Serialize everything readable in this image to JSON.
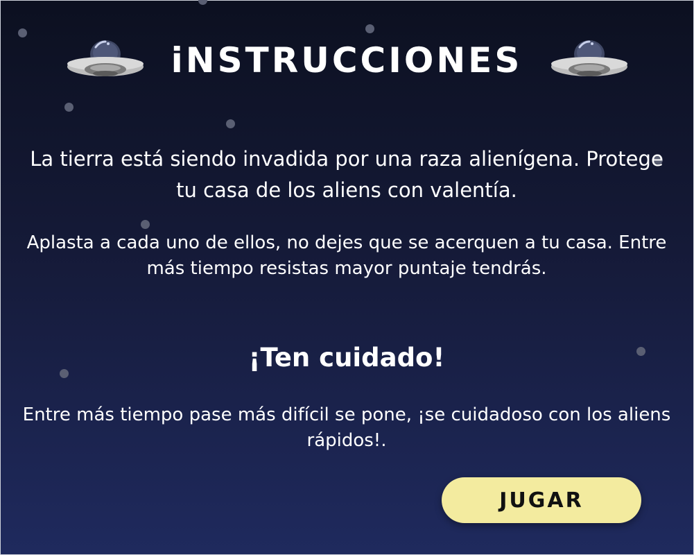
{
  "screen": {
    "title": "iNSTRUCCIONES",
    "paragraph_intro": "La tierra está siendo invadida por una raza alienígena. Protege tu casa de los aliens con valentía.",
    "paragraph_goal": "Aplasta a cada uno de ellos, no dejes que se acerquen a tu casa. Entre más tiempo resistas mayor puntaje tendrás.",
    "warning_heading": "¡Ten cuidado!",
    "paragraph_warning": "Entre más tiempo pase más difícil se pone, ¡se cuidadoso con los aliens rápidos!.",
    "play_button_label": "JUGAR"
  },
  "icons": {
    "left_decoration": "ufo-icon",
    "right_decoration": "ufo-icon"
  },
  "colors": {
    "background_top": "#0c1020",
    "background_bottom": "#1f2a5e",
    "text": "#ffffff",
    "button_bg": "#f3eb9f",
    "button_text": "#111111",
    "star": "#5a5f73"
  }
}
